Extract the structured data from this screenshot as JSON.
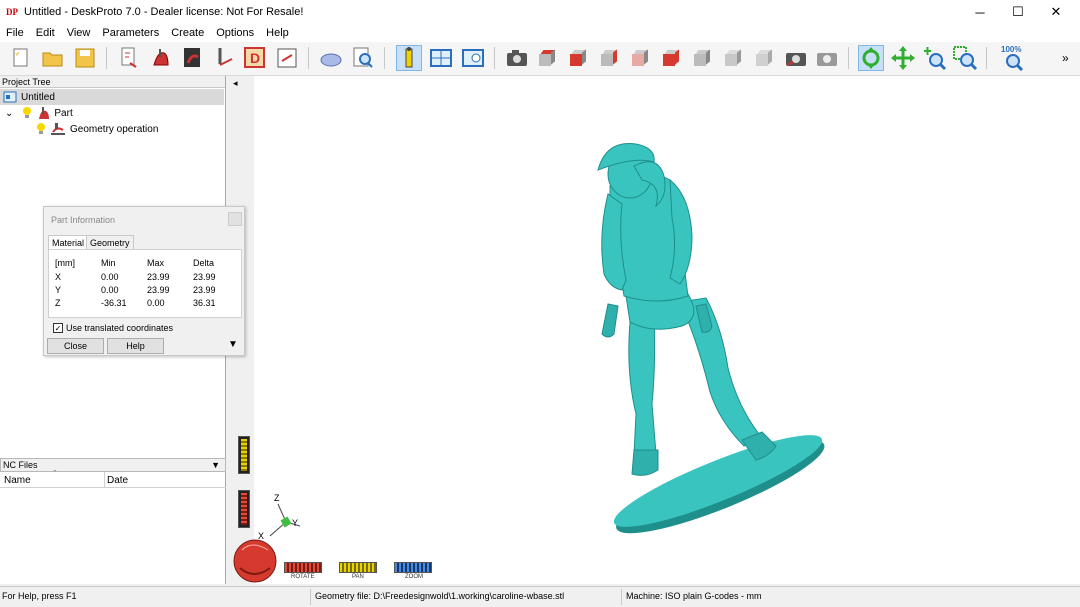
{
  "window": {
    "title": "Untitled - DeskProto 7.0 - Dealer license: Not For Resale!",
    "app_icon_text": "DP"
  },
  "menu": [
    "File",
    "Edit",
    "View",
    "Parameters",
    "Create",
    "Options",
    "Help"
  ],
  "toolbar": {
    "zoom_label": "100%",
    "overflow": "»"
  },
  "project_tree": {
    "header": "Project Tree",
    "items": [
      {
        "label": "Untitled",
        "selected": true
      },
      {
        "label": "Part"
      },
      {
        "label": "Geometry operation"
      }
    ]
  },
  "part_info": {
    "title": "Part Information",
    "tabs": [
      "Material",
      "Geometry"
    ],
    "active_tab": "Material",
    "columns": [
      "[mm]",
      "Min",
      "Max",
      "Delta"
    ],
    "rows": [
      [
        "X",
        "0.00",
        "23.99",
        "23.99"
      ],
      [
        "Y",
        "0.00",
        "23.99",
        "23.99"
      ],
      [
        "Z",
        "-36.31",
        "0.00",
        "36.31"
      ]
    ],
    "checkbox_label": "Use translated coordinates",
    "checkbox_checked": true,
    "close_button": "Close",
    "help_button": "Help"
  },
  "nc_files": {
    "header": "NC Files",
    "columns": [
      "Name",
      "Date"
    ]
  },
  "view_controls": {
    "rotate": "ROTATE",
    "pan": "PAN",
    "zoom": "ZOOM"
  },
  "axes": {
    "x": "X",
    "y": "Y",
    "z": "Z"
  },
  "status": {
    "help": "For Help, press F1",
    "geometry_file": "Geometry file: D:\\Freedesignwold\\1.working\\caroline-wbase.stl",
    "machine": "Machine: ISO plain G-codes - mm"
  },
  "colors": {
    "model": "#39c4c0",
    "model_dark": "#1f8f8c",
    "accent_active": "#c7e0f7"
  }
}
